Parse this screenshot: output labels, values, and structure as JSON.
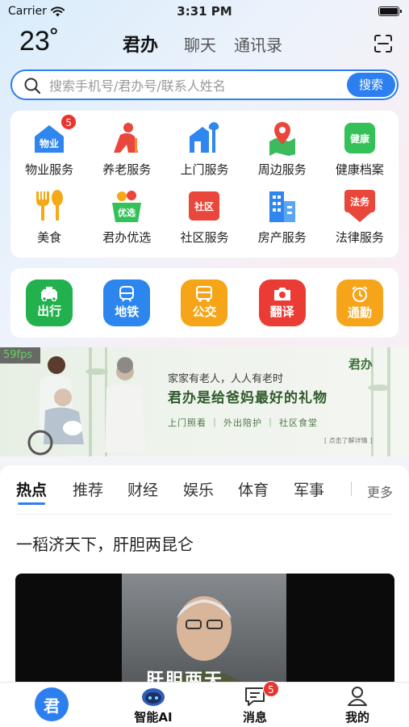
{
  "status_bar": {
    "carrier": "Carrier",
    "time": "3:31 PM"
  },
  "header": {
    "temperature": "23˚",
    "tabs": [
      {
        "label": "君办",
        "active": true
      },
      {
        "label": "聊天",
        "active": false
      },
      {
        "label": "通讯录",
        "active": false
      }
    ]
  },
  "search": {
    "placeholder": "搜索手机号/君办号/联系人姓名",
    "button_label": "搜索"
  },
  "services": [
    {
      "label": "物业服务",
      "icon": "property-icon",
      "badge": "5",
      "icon_text": "物业"
    },
    {
      "label": "养老服务",
      "icon": "elderly-care-icon"
    },
    {
      "label": "上门服务",
      "icon": "home-service-icon"
    },
    {
      "label": "周边服务",
      "icon": "location-pin-icon"
    },
    {
      "label": "健康档案",
      "icon": "health-record-icon",
      "icon_text": "健康"
    },
    {
      "label": "美食",
      "icon": "food-icon"
    },
    {
      "label": "君办优选",
      "icon": "shopping-basket-icon",
      "icon_text": "优选"
    },
    {
      "label": "社区服务",
      "icon": "community-icon",
      "icon_text": "社区"
    },
    {
      "label": "房产服务",
      "icon": "building-icon"
    },
    {
      "label": "法律服务",
      "icon": "law-icon",
      "icon_text": "法务"
    }
  ],
  "quick_actions": [
    {
      "label": "出行",
      "icon": "taxi-icon",
      "color": "#23b14d"
    },
    {
      "label": "地铁",
      "icon": "metro-icon",
      "color": "#2d86ee"
    },
    {
      "label": "公交",
      "icon": "bus-icon",
      "color": "#f5a517"
    },
    {
      "label": "翻译",
      "icon": "camera-icon",
      "color": "#ea3c35"
    },
    {
      "label": "通勤",
      "icon": "alarm-clock-icon",
      "color": "#f6a51b"
    }
  ],
  "fps": "59fps",
  "banner": {
    "brand": "君办",
    "line1": "家家有老人，人人有老时",
    "line2": "君办是给爸妈最好的礼物",
    "features": "上门照看 ｜ 外出陪护 ｜ 社区食堂",
    "cta": "[ 点击了解详情 ]"
  },
  "news": {
    "tabs": [
      "热点",
      "推荐",
      "财经",
      "娱乐",
      "体育",
      "军事"
    ],
    "more_label": "更多",
    "headline": "一稻济天下，肝胆两昆仑",
    "video_caption": "肝胆两天"
  },
  "tab_bar": [
    {
      "label": "",
      "icon": "home-logo-icon",
      "logo_text": "君"
    },
    {
      "label": "智能AI",
      "icon": "robot-icon"
    },
    {
      "label": "消息",
      "icon": "message-icon",
      "badge": "5"
    },
    {
      "label": "我的",
      "icon": "profile-icon"
    }
  ],
  "colors": {
    "accent": "#2d7ff0",
    "badge": "#e8352f"
  }
}
